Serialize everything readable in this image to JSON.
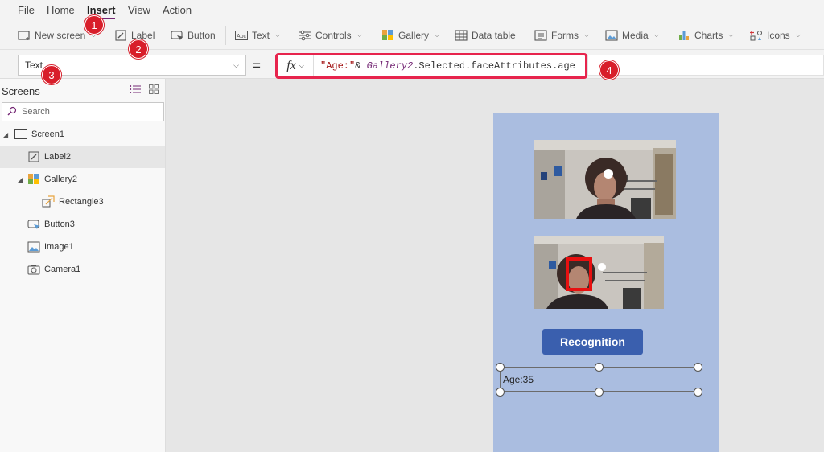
{
  "menu": {
    "items": [
      "File",
      "Home",
      "Insert",
      "View",
      "Action"
    ],
    "active": "Insert"
  },
  "ribbon": {
    "new_screen": "New screen",
    "label": "Label",
    "button": "Button",
    "text": "Text",
    "controls": "Controls",
    "gallery": "Gallery",
    "data_table": "Data table",
    "forms": "Forms",
    "media": "Media",
    "charts": "Charts",
    "icons": "Icons"
  },
  "formula_bar": {
    "property": "Text",
    "equals": "=",
    "fx": "fx",
    "formula": {
      "string": "\"Age:\"",
      "op": "& ",
      "identifier": "Gallery2",
      "rest": ".Selected.faceAttributes.age"
    }
  },
  "badges": [
    "1",
    "2",
    "3",
    "4"
  ],
  "left_panel": {
    "title": "Screens",
    "search_placeholder": "Search",
    "tree": [
      {
        "label": "Screen1",
        "icon": "screen-icon"
      },
      {
        "label": "Label2",
        "icon": "label-edit-icon",
        "selected": true
      },
      {
        "label": "Gallery2",
        "icon": "gallery-icon"
      },
      {
        "label": "Rectangle3",
        "icon": "rectangle-shape-icon"
      },
      {
        "label": "Button3",
        "icon": "button-icon"
      },
      {
        "label": "Image1",
        "icon": "image-icon"
      },
      {
        "label": "Camera1",
        "icon": "camera-icon"
      }
    ]
  },
  "app_screen": {
    "button_label": "Recognition",
    "age_label": "Age:35"
  },
  "colors": {
    "accent": "#742774",
    "highlight_red": "#e7244d",
    "screen_bg": "#aabde0",
    "button_bg": "#3a5fae"
  }
}
